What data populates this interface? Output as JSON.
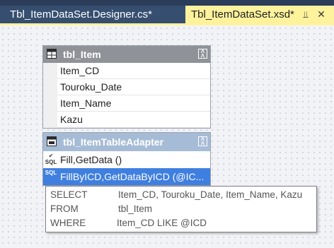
{
  "tabs": [
    {
      "label": "Tbl_ItemDataSet.Designer.cs*",
      "active": false
    },
    {
      "label": "Tbl_ItemDataSet.xsd*",
      "active": true
    }
  ],
  "tab_icons": {
    "pin": "pin-icon",
    "close": "close-icon"
  },
  "table": {
    "title": "tbl_Item",
    "icon": "table-icon",
    "columns": [
      "Item_CD",
      "Touroku_Date",
      "Item_Name",
      "Kazu"
    ]
  },
  "adapter": {
    "title": "tbl_ItemTableAdapter",
    "icon": "table-adapter-icon",
    "queries": [
      {
        "label": "Fill,GetData ()",
        "icon": "sql-query-icon",
        "selected": false
      },
      {
        "label": "FillByICD,GetDataByICD (@IC...",
        "icon": "sql-query-icon",
        "selected": true
      }
    ]
  },
  "tooltip": {
    "lines": [
      {
        "keyword": "SELECT",
        "value": "Item_CD, Touroku_Date, Item_Name, Kazu"
      },
      {
        "keyword": "FROM",
        "value": "tbl_Item"
      },
      {
        "keyword": "WHERE",
        "value": "Item_CD LIKE @ICD"
      }
    ]
  },
  "colors": {
    "tab_strip": "#2c3d5a",
    "active_tab": "#fff29d",
    "table_header": "#8f9398",
    "adapter_header": "#a6bcd6",
    "selection": "#3f7fe0"
  }
}
